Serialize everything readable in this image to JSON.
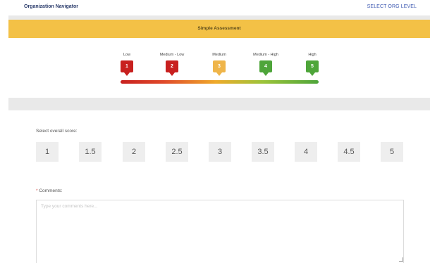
{
  "header": {
    "app_title": "Organization Navigator",
    "org_link": "SELECT ORG LEVEL"
  },
  "banner": {
    "title": "Simple Assessment"
  },
  "scale": {
    "markers": [
      {
        "label": "Low",
        "value": "1",
        "color": "#c8201f"
      },
      {
        "label": "Medium - Low",
        "value": "2",
        "color": "#c8201f"
      },
      {
        "label": "Medium",
        "value": "3",
        "color": "#efb54a"
      },
      {
        "label": "Medium - High",
        "value": "4",
        "color": "#4ea53a"
      },
      {
        "label": "High",
        "value": "5",
        "color": "#4ea53a"
      }
    ]
  },
  "score": {
    "label": "Select overall score:",
    "options": [
      "1",
      "1.5",
      "2",
      "2.5",
      "3",
      "3.5",
      "4",
      "4.5",
      "5"
    ]
  },
  "comments": {
    "required_mark": "*",
    "label": "Comments:",
    "placeholder": "Type your comments here..."
  },
  "colors": {
    "banner": "#f3c146",
    "link": "#3a56b0",
    "title": "#2a3b6b"
  }
}
